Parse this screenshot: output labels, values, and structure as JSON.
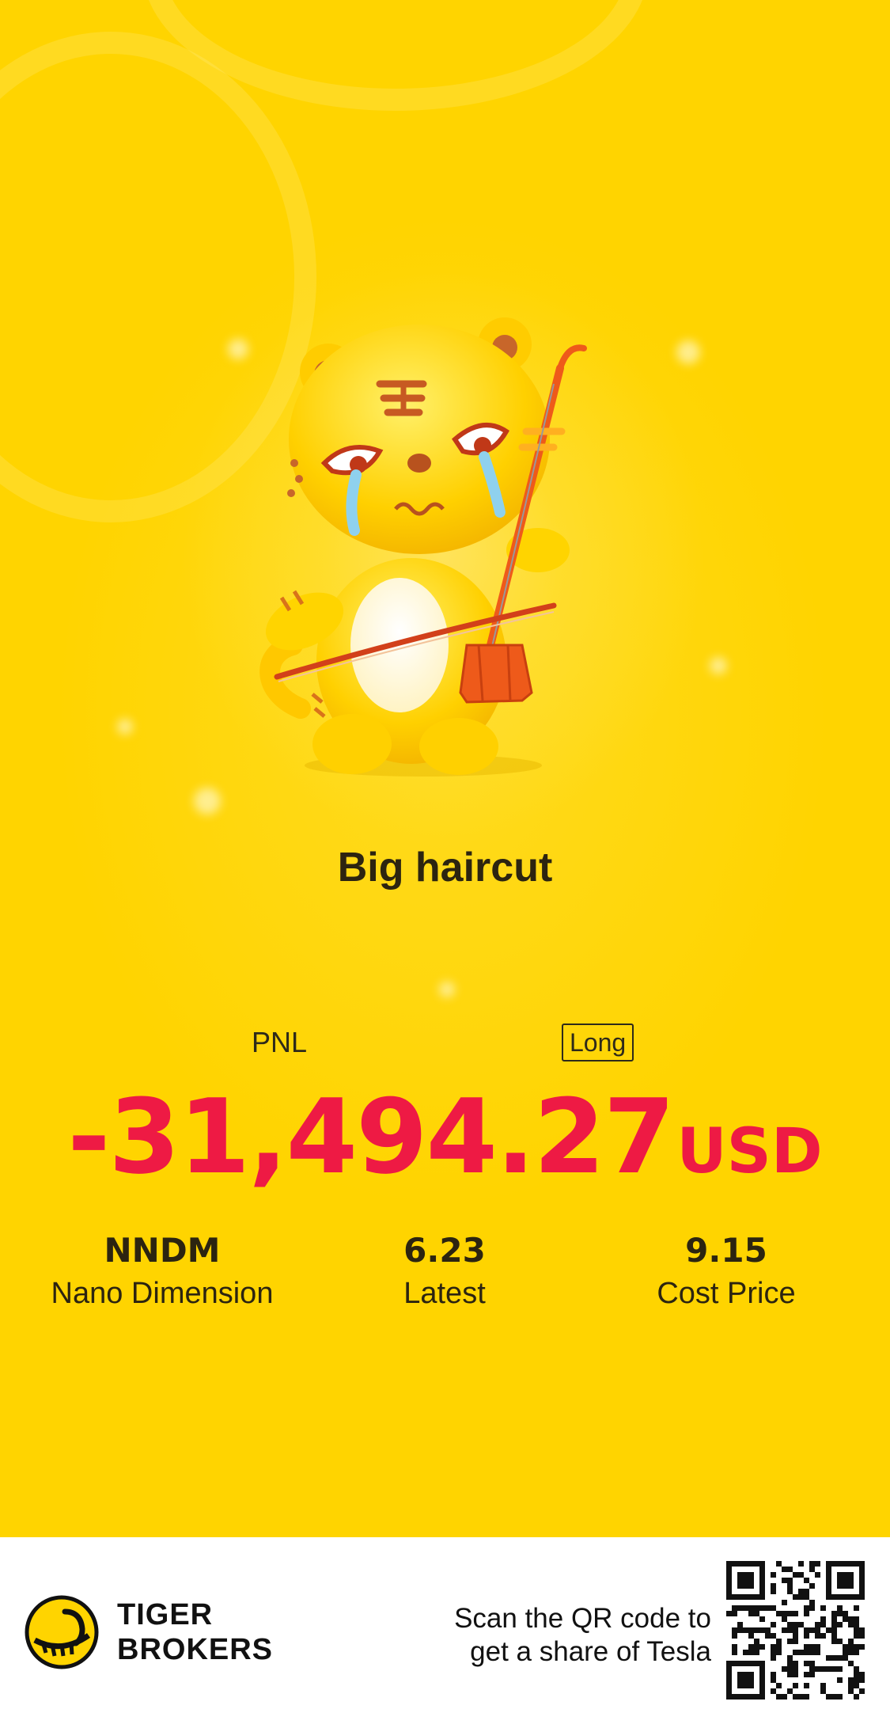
{
  "headline": "Big haircut",
  "pnl": {
    "label": "PNL",
    "position_side": "Long",
    "value": "-31,494.27",
    "currency": "USD",
    "color": "#ee1a44"
  },
  "stats": [
    {
      "value": "NNDM",
      "label": "Nano Dimension"
    },
    {
      "value": "6.23",
      "label": "Latest"
    },
    {
      "value": "9.15",
      "label": "Cost Price"
    }
  ],
  "footer": {
    "brand_line1": "TIGER",
    "brand_line2": "BROKERS",
    "scan_line1": "Scan the QR code to",
    "scan_line2": "get a share of Tesla",
    "logo_icon": "tiger-logo-icon",
    "qr_icon": "qr-code-icon"
  },
  "colors": {
    "background": "#ffd400",
    "footer_bg": "#ffffff"
  }
}
